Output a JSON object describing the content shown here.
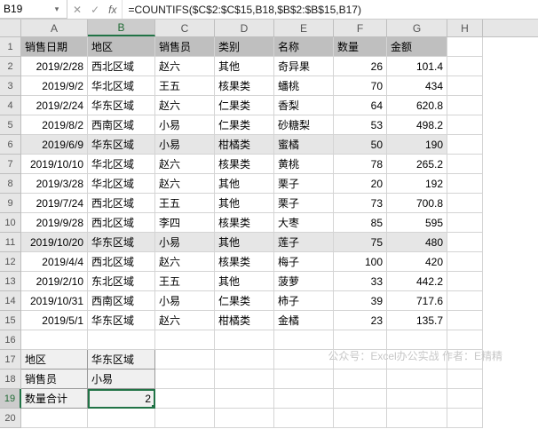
{
  "name_box": "B19",
  "formula": "=COUNTIFS($C$2:$C$15,B18,$B$2:$B$15,B17)",
  "columns": [
    "A",
    "B",
    "C",
    "D",
    "E",
    "F",
    "G",
    "H"
  ],
  "col_widths": [
    "wA",
    "wB",
    "wC",
    "wD",
    "wE",
    "wF",
    "wG",
    "wH"
  ],
  "selected_col_idx": 1,
  "header": [
    "销售日期",
    "地区",
    "销售员",
    "类别",
    "名称",
    "数量",
    "金额"
  ],
  "rows": [
    {
      "r": 2,
      "band": false,
      "销售日期": "2019/2/28",
      "地区": "西北区域",
      "销售员": "赵六",
      "类别": "其他",
      "名称": "奇异果",
      "数量": "26",
      "金额": "101.4"
    },
    {
      "r": 3,
      "band": false,
      "销售日期": "2019/9/2",
      "地区": "华北区域",
      "销售员": "王五",
      "类别": "核果类",
      "名称": "蟠桃",
      "数量": "70",
      "金额": "434"
    },
    {
      "r": 4,
      "band": false,
      "销售日期": "2019/2/24",
      "地区": "华东区域",
      "销售员": "赵六",
      "类别": "仁果类",
      "名称": "香梨",
      "数量": "64",
      "金额": "620.8"
    },
    {
      "r": 5,
      "band": false,
      "销售日期": "2019/8/2",
      "地区": "西南区域",
      "销售员": "小易",
      "类别": "仁果类",
      "名称": "砂糖梨",
      "数量": "53",
      "金额": "498.2"
    },
    {
      "r": 6,
      "band": true,
      "销售日期": "2019/6/9",
      "地区": "华东区域",
      "销售员": "小易",
      "类别": "柑橘类",
      "名称": "蜜橘",
      "数量": "50",
      "金额": "190"
    },
    {
      "r": 7,
      "band": false,
      "销售日期": "2019/10/10",
      "地区": "华北区域",
      "销售员": "赵六",
      "类别": "核果类",
      "名称": "黄桃",
      "数量": "78",
      "金额": "265.2"
    },
    {
      "r": 8,
      "band": false,
      "销售日期": "2019/3/28",
      "地区": "华北区域",
      "销售员": "赵六",
      "类别": "其他",
      "名称": "栗子",
      "数量": "20",
      "金额": "192"
    },
    {
      "r": 9,
      "band": false,
      "销售日期": "2019/7/24",
      "地区": "西北区域",
      "销售员": "王五",
      "类别": "其他",
      "名称": "栗子",
      "数量": "73",
      "金额": "700.8"
    },
    {
      "r": 10,
      "band": false,
      "销售日期": "2019/9/28",
      "地区": "西北区域",
      "销售员": "李四",
      "类别": "核果类",
      "名称": "大枣",
      "数量": "85",
      "金额": "595"
    },
    {
      "r": 11,
      "band": true,
      "销售日期": "2019/10/20",
      "地区": "华东区域",
      "销售员": "小易",
      "类别": "其他",
      "名称": "莲子",
      "数量": "75",
      "金额": "480"
    },
    {
      "r": 12,
      "band": false,
      "销售日期": "2019/4/4",
      "地区": "西北区域",
      "销售员": "赵六",
      "类别": "核果类",
      "名称": "梅子",
      "数量": "100",
      "金额": "420"
    },
    {
      "r": 13,
      "band": false,
      "销售日期": "2019/2/10",
      "地区": "东北区域",
      "销售员": "王五",
      "类别": "其他",
      "名称": "菠萝",
      "数量": "33",
      "金额": "442.2"
    },
    {
      "r": 14,
      "band": false,
      "销售日期": "2019/10/31",
      "地区": "西南区域",
      "销售员": "小易",
      "类别": "仁果类",
      "名称": "柿子",
      "数量": "39",
      "金额": "717.6"
    },
    {
      "r": 15,
      "band": false,
      "销售日期": "2019/5/1",
      "地区": "华东区域",
      "销售员": "赵六",
      "类别": "柑橘类",
      "名称": "金橘",
      "数量": "23",
      "金额": "135.7"
    }
  ],
  "summary": {
    "r17_a": "地区",
    "r17_b": "华东区域",
    "r18_a": "销售员",
    "r18_b": "小易",
    "r19_a": "数量合计",
    "r19_b": "2"
  },
  "selected_row": 19,
  "watermark": "公众号：Excel办公实战 作者：E精精"
}
